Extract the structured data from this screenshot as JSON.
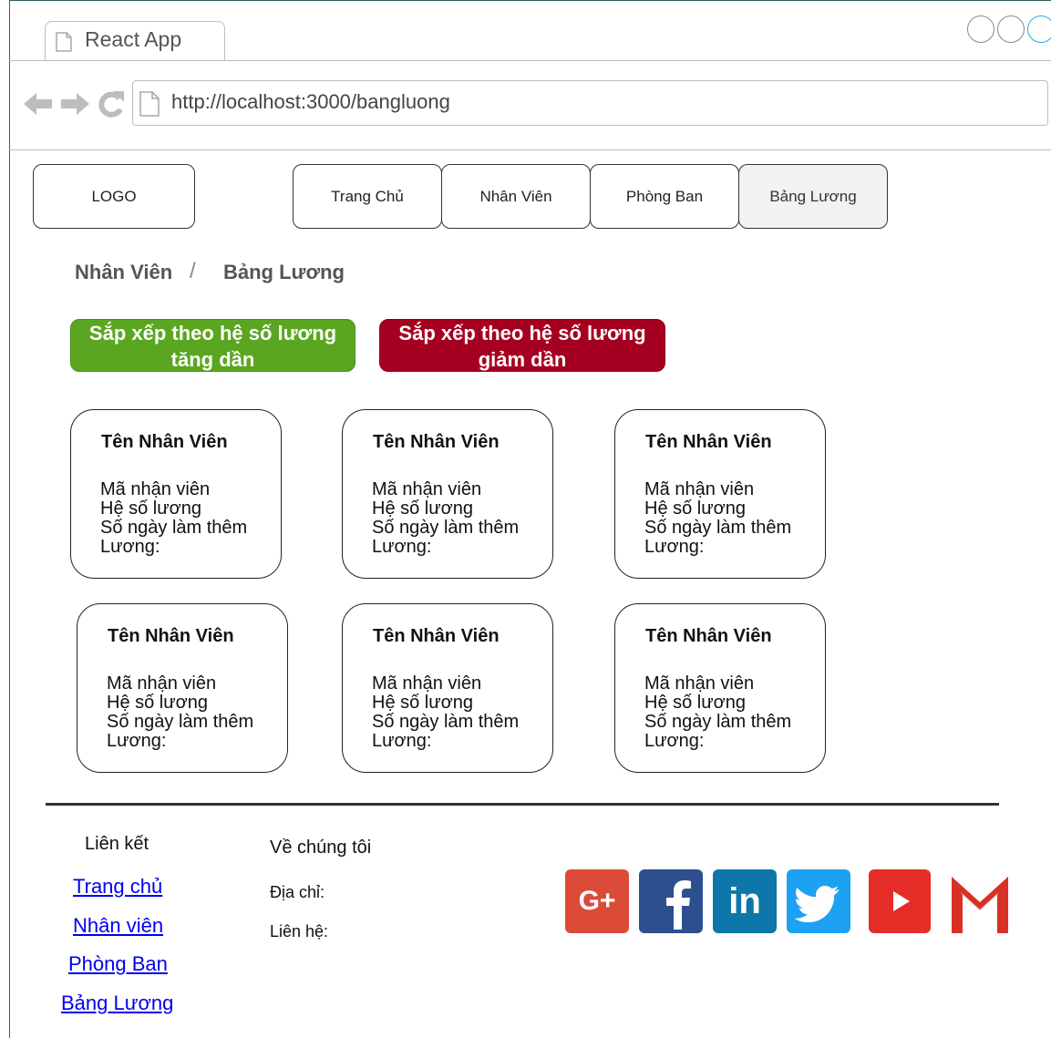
{
  "browser": {
    "tab_title": "React App",
    "url": "http://localhost:3000/bangluong"
  },
  "nav": {
    "logo": "LOGO",
    "items": [
      {
        "label": "Trang Chủ",
        "active": false
      },
      {
        "label": "Nhân Viên",
        "active": false
      },
      {
        "label": "Phòng Ban",
        "active": false
      },
      {
        "label": "Bảng Lương",
        "active": true
      }
    ]
  },
  "breadcrumb": {
    "parent": "Nhân Viên",
    "separator": "/",
    "current": "Bảng Lương"
  },
  "sort": {
    "asc_line1": "Sắp xếp theo hệ số lương",
    "asc_line2": "tăng dần",
    "desc_line1": "Sắp xếp theo hệ số lương",
    "desc_line2": "giảm dần",
    "asc_color": "#5aa621",
    "desc_color": "#a50021"
  },
  "cards": [
    {
      "name": "Tên Nhân Viên",
      "id": "Mã nhận viên",
      "coef": "Hệ số lương",
      "overtime": "Số ngày làm thêm",
      "salary": "Lương:"
    },
    {
      "name": "Tên Nhân Viên",
      "id": "Mã nhận viên",
      "coef": "Hệ số lương",
      "overtime": "Số ngày làm thêm",
      "salary": "Lương:"
    },
    {
      "name": "Tên Nhân Viên",
      "id": "Mã nhận viên",
      "coef": "Hệ số lương",
      "overtime": "Số ngày làm thêm",
      "salary": "Lương:"
    },
    {
      "name": "Tên Nhân Viên",
      "id": "Mã nhận viên",
      "coef": "Hệ số lương",
      "overtime": "Số ngày làm thêm",
      "salary": "Lương:"
    },
    {
      "name": "Tên Nhân Viên",
      "id": "Mã nhận viên",
      "coef": "Hệ số lương",
      "overtime": "Số ngày làm thêm",
      "salary": "Lương:"
    },
    {
      "name": "Tên Nhân Viên",
      "id": "Mã nhận viên",
      "coef": "Hệ số lương",
      "overtime": "Số ngày làm thêm",
      "salary": "Lương:"
    }
  ],
  "footer": {
    "links_heading": "Liên kết",
    "links": [
      "Trang chủ",
      "Nhân viên",
      "Phòng Ban",
      "Bảng Lương"
    ],
    "about_heading": "Về chúng tôi",
    "address_label": "Địa chỉ:",
    "contact_label": "Liên hệ:",
    "social": [
      {
        "name": "google-plus-icon",
        "glyph": "G+",
        "color": "#dc4a38"
      },
      {
        "name": "facebook-icon",
        "glyph": "f",
        "color": "#2d4f8e"
      },
      {
        "name": "linkedin-icon",
        "glyph": "in",
        "color": "#0e76a8"
      },
      {
        "name": "twitter-icon",
        "glyph": "🐦",
        "color": "#1da1f2"
      },
      {
        "name": "youtube-icon",
        "glyph": "▶",
        "color": "#e52d27"
      },
      {
        "name": "gmail-icon",
        "glyph": "M",
        "color": "#d93025"
      }
    ]
  }
}
